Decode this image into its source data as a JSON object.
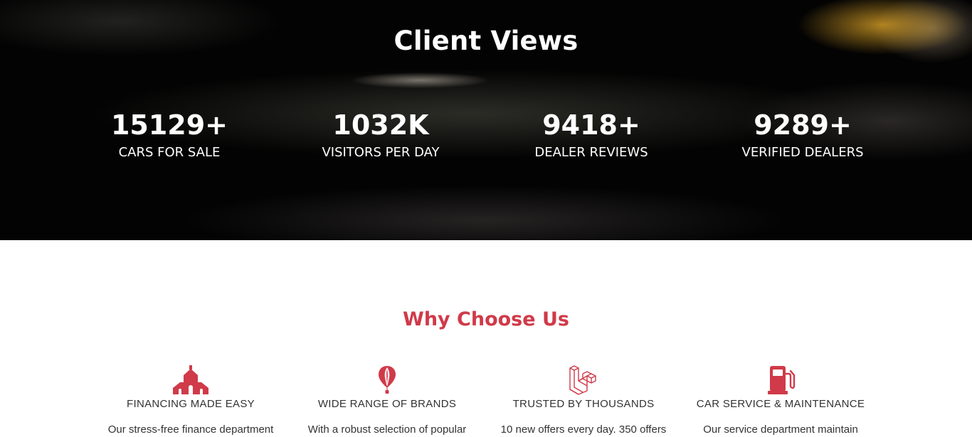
{
  "hero": {
    "title": "Client Views",
    "stats": [
      {
        "value": "15129+",
        "label": "CARS FOR SALE"
      },
      {
        "value": "1032K",
        "label": "VISITORS PER DAY"
      },
      {
        "value": "9418+",
        "label": "DEALER REVIEWS"
      },
      {
        "value": "9289+",
        "label": "VERIFIED DEALERS"
      }
    ]
  },
  "why": {
    "title": "Why Choose Us",
    "accent_color": "#d03a49",
    "features": [
      {
        "icon": "bank-icon",
        "title": "FINANCING MADE EASY",
        "desc": "Our stress-free finance department"
      },
      {
        "icon": "balloon-icon",
        "title": "WIDE RANGE OF BRANDS",
        "desc": "With a robust selection of popular"
      },
      {
        "icon": "laravel-icon",
        "title": "TRUSTED BY THOUSANDS",
        "desc": "10 new offers every day. 350 offers"
      },
      {
        "icon": "fuel-pump-icon",
        "title": "CAR SERVICE & MAINTENANCE",
        "desc": "Our service department maintain"
      }
    ]
  }
}
